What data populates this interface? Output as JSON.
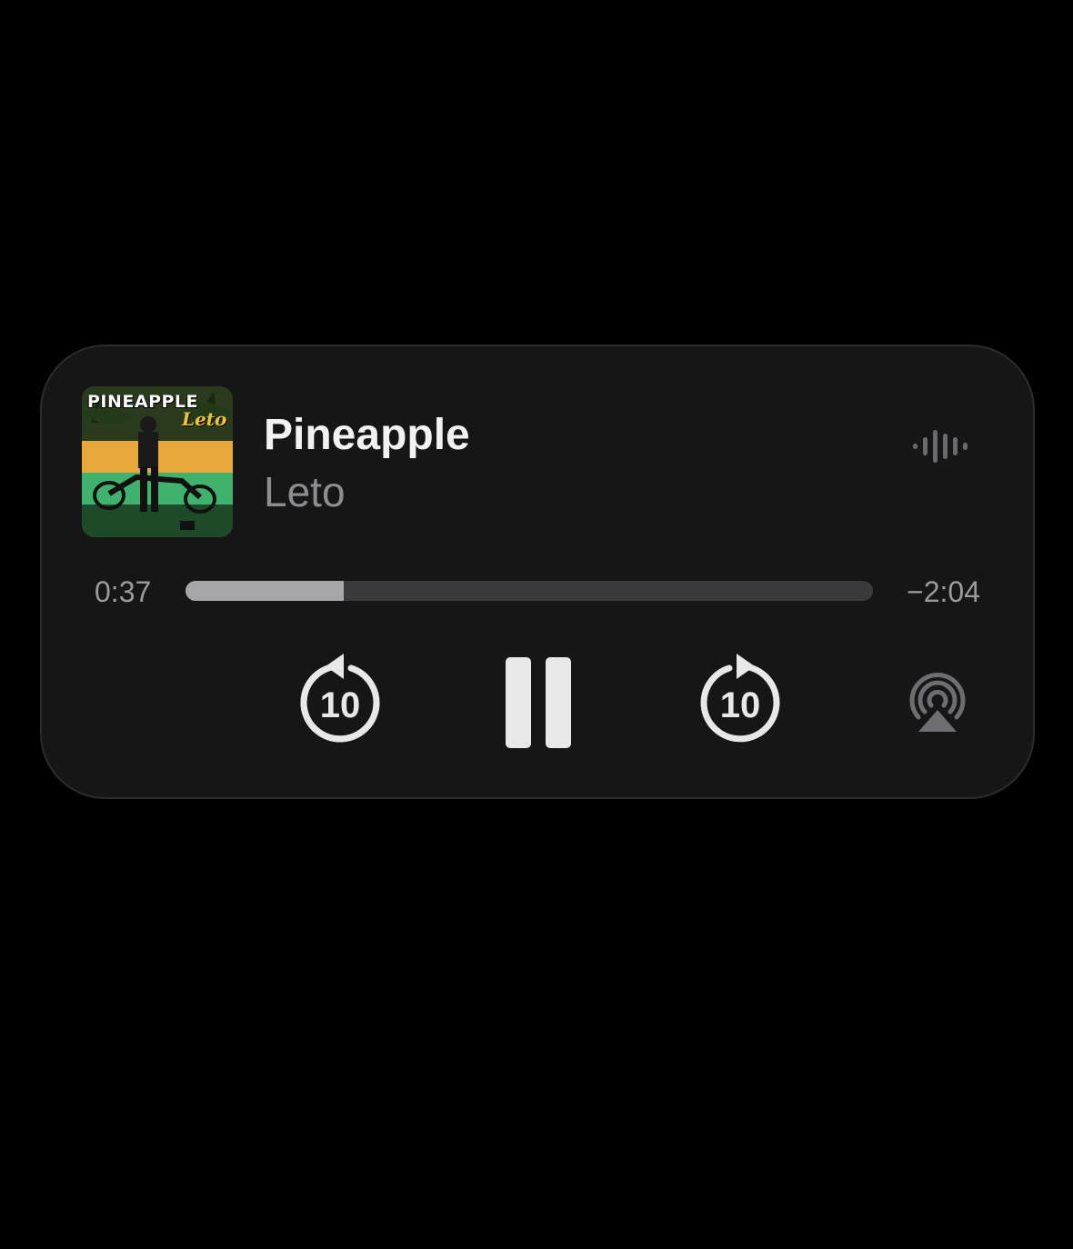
{
  "track": {
    "title": "Pineapple",
    "artist": "Leto",
    "artwork": {
      "title_text": "PINEAPPLE",
      "artist_text": "Leto"
    }
  },
  "playback": {
    "elapsed": "0:37",
    "remaining": "−2:04",
    "progress_fraction": 0.23,
    "state": "playing"
  },
  "controls": {
    "skip_back_label": "10",
    "skip_forward_label": "10",
    "skip_back_icon": "gobackward-10-icon",
    "pause_icon": "pause-icon",
    "skip_forward_icon": "goforward-10-icon",
    "airplay_icon": "airplay-audio-icon",
    "waveform_icon": "waveform-icon"
  },
  "colors": {
    "background": "#000000",
    "panel": "#161616",
    "title": "#f2f2f2",
    "subtitle": "#8e8e92",
    "progress_fill": "#a5a5aa",
    "progress_track": "#3a3a3c",
    "control_fill": "#e8e8e8",
    "airplay": "#6e6e72"
  }
}
